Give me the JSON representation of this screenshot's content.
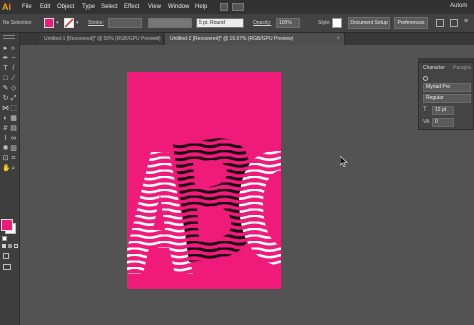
{
  "app": {
    "logo": "Ai",
    "workspace": "Autom"
  },
  "menu": [
    "File",
    "Edit",
    "Object",
    "Type",
    "Select",
    "Effect",
    "View",
    "Window",
    "Help"
  ],
  "control_bar": {
    "selection": "No Selection",
    "stroke_label": "Stroke:",
    "brush": "5 pt. Round",
    "opacity_label": "Opacity:",
    "opacity_value": "100%",
    "style_label": "Style:",
    "document_setup": "Document Setup",
    "preferences": "Preferences",
    "fill_color": "#f01a7a"
  },
  "tabs": [
    {
      "label": "Untitled-1 [Recovered]* @ 50% (RGB/GPU Preview)",
      "active": false
    },
    {
      "label": "Untitled-2 [Recovered]* @ 16.67% (RGB/GPU Preview)",
      "active": true
    }
  ],
  "artwork": {
    "text": "ABC",
    "background": "#f01a7a"
  },
  "character_panel": {
    "tab_character": "Character",
    "tab_paragraph": "Paragra",
    "font": "Myriad Pro",
    "style": "Regular",
    "size": "12 pt",
    "tracking": "0"
  },
  "icons": [
    "selection-tool-icon",
    "direct-selection-icon",
    "pen-tool-icon",
    "type-tool-icon",
    "line-tool-icon",
    "rectangle-tool-icon",
    "brush-tool-icon",
    "pencil-tool-icon",
    "eraser-tool-icon",
    "rotate-tool-icon",
    "scale-tool-icon",
    "width-tool-icon",
    "free-transform-icon",
    "shape-builder-icon",
    "perspective-grid-icon",
    "mesh-tool-icon",
    "gradient-tool-icon",
    "eyedropper-tool-icon",
    "blend-tool-icon",
    "symbol-sprayer-icon",
    "graph-tool-icon",
    "artboard-tool-icon",
    "slice-tool-icon",
    "hand-tool-icon",
    "zoom-tool-icon"
  ]
}
